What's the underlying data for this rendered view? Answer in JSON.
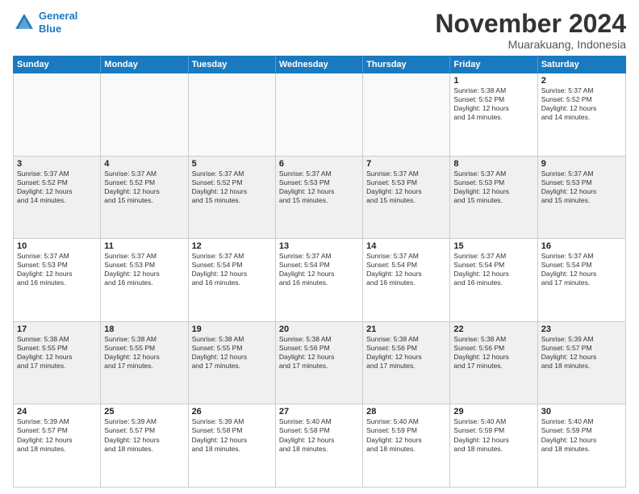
{
  "header": {
    "logo_line1": "General",
    "logo_line2": "Blue",
    "month_title": "November 2024",
    "location": "Muarakuang, Indonesia"
  },
  "weekdays": [
    "Sunday",
    "Monday",
    "Tuesday",
    "Wednesday",
    "Thursday",
    "Friday",
    "Saturday"
  ],
  "rows": [
    [
      {
        "day": "",
        "info": "",
        "empty": true
      },
      {
        "day": "",
        "info": "",
        "empty": true
      },
      {
        "day": "",
        "info": "",
        "empty": true
      },
      {
        "day": "",
        "info": "",
        "empty": true
      },
      {
        "day": "",
        "info": "",
        "empty": true
      },
      {
        "day": "1",
        "info": "Sunrise: 5:38 AM\nSunset: 5:52 PM\nDaylight: 12 hours\nand 14 minutes.",
        "empty": false
      },
      {
        "day": "2",
        "info": "Sunrise: 5:37 AM\nSunset: 5:52 PM\nDaylight: 12 hours\nand 14 minutes.",
        "empty": false
      }
    ],
    [
      {
        "day": "3",
        "info": "Sunrise: 5:37 AM\nSunset: 5:52 PM\nDaylight: 12 hours\nand 14 minutes.",
        "empty": false
      },
      {
        "day": "4",
        "info": "Sunrise: 5:37 AM\nSunset: 5:52 PM\nDaylight: 12 hours\nand 15 minutes.",
        "empty": false
      },
      {
        "day": "5",
        "info": "Sunrise: 5:37 AM\nSunset: 5:52 PM\nDaylight: 12 hours\nand 15 minutes.",
        "empty": false
      },
      {
        "day": "6",
        "info": "Sunrise: 5:37 AM\nSunset: 5:53 PM\nDaylight: 12 hours\nand 15 minutes.",
        "empty": false
      },
      {
        "day": "7",
        "info": "Sunrise: 5:37 AM\nSunset: 5:53 PM\nDaylight: 12 hours\nand 15 minutes.",
        "empty": false
      },
      {
        "day": "8",
        "info": "Sunrise: 5:37 AM\nSunset: 5:53 PM\nDaylight: 12 hours\nand 15 minutes.",
        "empty": false
      },
      {
        "day": "9",
        "info": "Sunrise: 5:37 AM\nSunset: 5:53 PM\nDaylight: 12 hours\nand 15 minutes.",
        "empty": false
      }
    ],
    [
      {
        "day": "10",
        "info": "Sunrise: 5:37 AM\nSunset: 5:53 PM\nDaylight: 12 hours\nand 16 minutes.",
        "empty": false
      },
      {
        "day": "11",
        "info": "Sunrise: 5:37 AM\nSunset: 5:53 PM\nDaylight: 12 hours\nand 16 minutes.",
        "empty": false
      },
      {
        "day": "12",
        "info": "Sunrise: 5:37 AM\nSunset: 5:54 PM\nDaylight: 12 hours\nand 16 minutes.",
        "empty": false
      },
      {
        "day": "13",
        "info": "Sunrise: 5:37 AM\nSunset: 5:54 PM\nDaylight: 12 hours\nand 16 minutes.",
        "empty": false
      },
      {
        "day": "14",
        "info": "Sunrise: 5:37 AM\nSunset: 5:54 PM\nDaylight: 12 hours\nand 16 minutes.",
        "empty": false
      },
      {
        "day": "15",
        "info": "Sunrise: 5:37 AM\nSunset: 5:54 PM\nDaylight: 12 hours\nand 16 minutes.",
        "empty": false
      },
      {
        "day": "16",
        "info": "Sunrise: 5:37 AM\nSunset: 5:54 PM\nDaylight: 12 hours\nand 17 minutes.",
        "empty": false
      }
    ],
    [
      {
        "day": "17",
        "info": "Sunrise: 5:38 AM\nSunset: 5:55 PM\nDaylight: 12 hours\nand 17 minutes.",
        "empty": false
      },
      {
        "day": "18",
        "info": "Sunrise: 5:38 AM\nSunset: 5:55 PM\nDaylight: 12 hours\nand 17 minutes.",
        "empty": false
      },
      {
        "day": "19",
        "info": "Sunrise: 5:38 AM\nSunset: 5:55 PM\nDaylight: 12 hours\nand 17 minutes.",
        "empty": false
      },
      {
        "day": "20",
        "info": "Sunrise: 5:38 AM\nSunset: 5:56 PM\nDaylight: 12 hours\nand 17 minutes.",
        "empty": false
      },
      {
        "day": "21",
        "info": "Sunrise: 5:38 AM\nSunset: 5:56 PM\nDaylight: 12 hours\nand 17 minutes.",
        "empty": false
      },
      {
        "day": "22",
        "info": "Sunrise: 5:38 AM\nSunset: 5:56 PM\nDaylight: 12 hours\nand 17 minutes.",
        "empty": false
      },
      {
        "day": "23",
        "info": "Sunrise: 5:39 AM\nSunset: 5:57 PM\nDaylight: 12 hours\nand 18 minutes.",
        "empty": false
      }
    ],
    [
      {
        "day": "24",
        "info": "Sunrise: 5:39 AM\nSunset: 5:57 PM\nDaylight: 12 hours\nand 18 minutes.",
        "empty": false
      },
      {
        "day": "25",
        "info": "Sunrise: 5:39 AM\nSunset: 5:57 PM\nDaylight: 12 hours\nand 18 minutes.",
        "empty": false
      },
      {
        "day": "26",
        "info": "Sunrise: 5:39 AM\nSunset: 5:58 PM\nDaylight: 12 hours\nand 18 minutes.",
        "empty": false
      },
      {
        "day": "27",
        "info": "Sunrise: 5:40 AM\nSunset: 5:58 PM\nDaylight: 12 hours\nand 18 minutes.",
        "empty": false
      },
      {
        "day": "28",
        "info": "Sunrise: 5:40 AM\nSunset: 5:59 PM\nDaylight: 12 hours\nand 18 minutes.",
        "empty": false
      },
      {
        "day": "29",
        "info": "Sunrise: 5:40 AM\nSunset: 5:59 PM\nDaylight: 12 hours\nand 18 minutes.",
        "empty": false
      },
      {
        "day": "30",
        "info": "Sunrise: 5:40 AM\nSunset: 5:59 PM\nDaylight: 12 hours\nand 18 minutes.",
        "empty": false
      }
    ]
  ]
}
